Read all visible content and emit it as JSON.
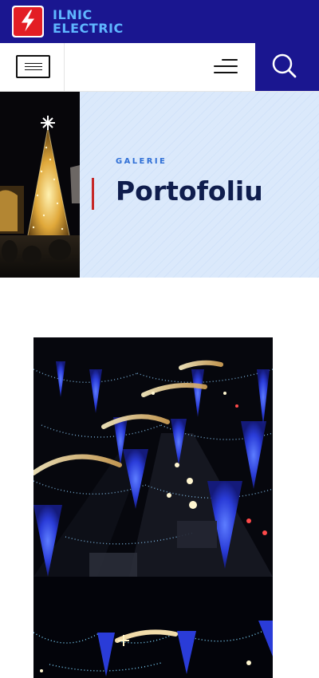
{
  "brand": {
    "line1": "ILNIC",
    "line2": "ELECTRIC",
    "logo_icon": "lightning-bolt-icon",
    "colors": {
      "header_bg": "#1a1690",
      "logo_text": "#5fb6ff",
      "logo_mark": "#e31e24"
    }
  },
  "navbar": {
    "menu_button_icon": "menu-lines-icon",
    "hamburger_icon": "hamburger-icon",
    "search_icon": "search-icon"
  },
  "hero": {
    "eyebrow": "GALERIE",
    "title": "Portofoliu",
    "colors": {
      "accent": "#c62828",
      "title": "#0f1d4d",
      "eyebrow": "#2f6fd6",
      "panel_bg": "#dbe9fb"
    }
  },
  "gallery": {
    "images": [
      {
        "name": "christmas-street-lights-photo"
      },
      {
        "name": "christmas-garland-photo"
      }
    ]
  }
}
